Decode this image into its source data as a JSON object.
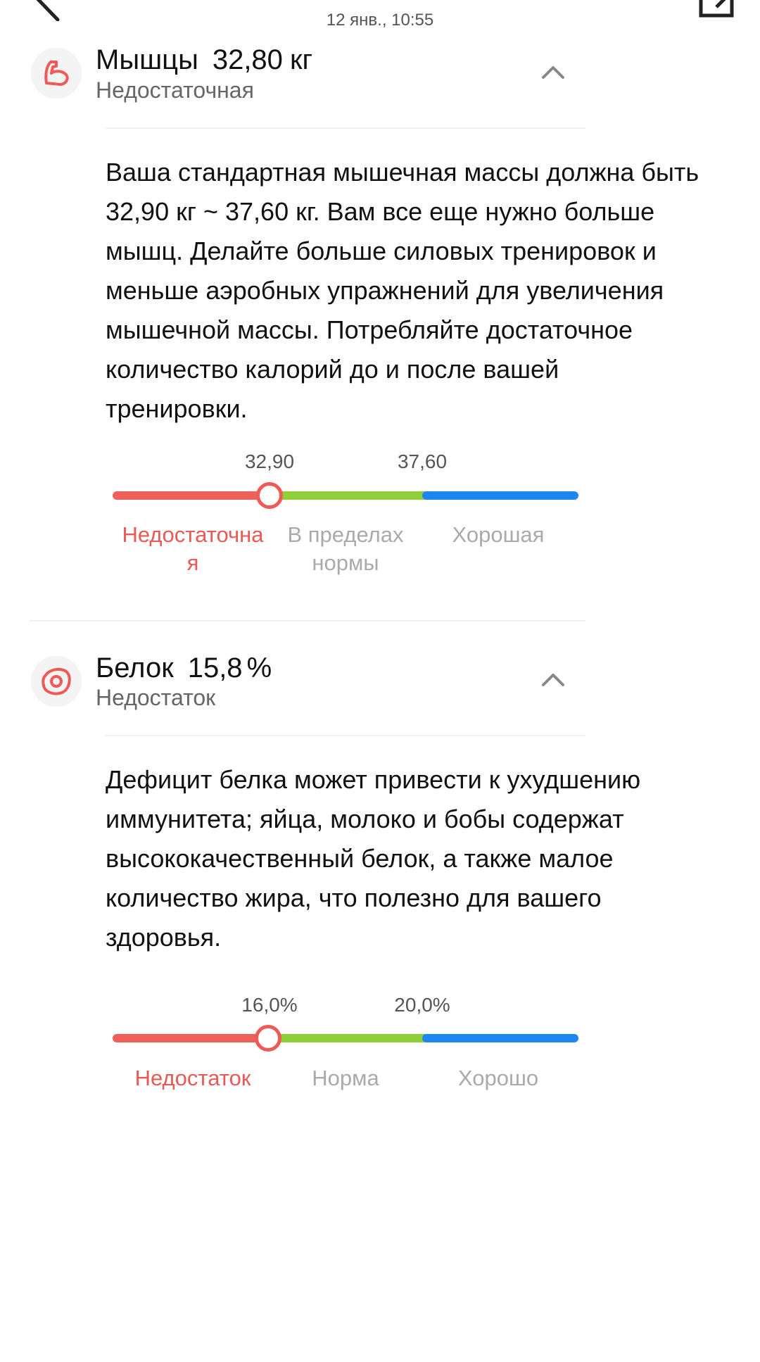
{
  "header": {
    "timestamp": "12 янв., 10:55"
  },
  "metrics": [
    {
      "name": "Мышцы",
      "value": "32,80",
      "unit": "кг",
      "status": "Недостаточная",
      "icon": "muscle-icon",
      "description": "Ваша стандартная мышечная массы должна быть 32,90 кг ~ 37,60 кг. Вам все еще нужно больше мышц. Делайте больше силовых тренировок и меньше аэробных упражнений для увеличения мышечной массы. Потребляйте достаточное количество калорий до и после вашей тренировки.",
      "thresholds": [
        "32,90",
        "37,60"
      ],
      "categories": [
        "Недостаточна\nя",
        "В пределах\nнормы",
        "Хорошая"
      ],
      "active_category": 0,
      "colors": [
        "#f0605a",
        "#8fcf3a",
        "#1e86f0"
      ]
    },
    {
      "name": "Белок",
      "value": "15,8",
      "unit": "%",
      "status": "Недостаток",
      "icon": "protein-icon",
      "description": "Дефицит белка может привести к ухудшению иммунитета; яйца, молоко и бобы содержат высококачественный белок, а также малое количество жира, что полезно для вашего здоровья.",
      "thresholds": [
        "16,0%",
        "20,0%"
      ],
      "categories": [
        "Недостаток",
        "Норма",
        "Хорошо"
      ],
      "active_category": 0,
      "colors": [
        "#f0605a",
        "#8fcf3a",
        "#1e86f0"
      ]
    }
  ]
}
